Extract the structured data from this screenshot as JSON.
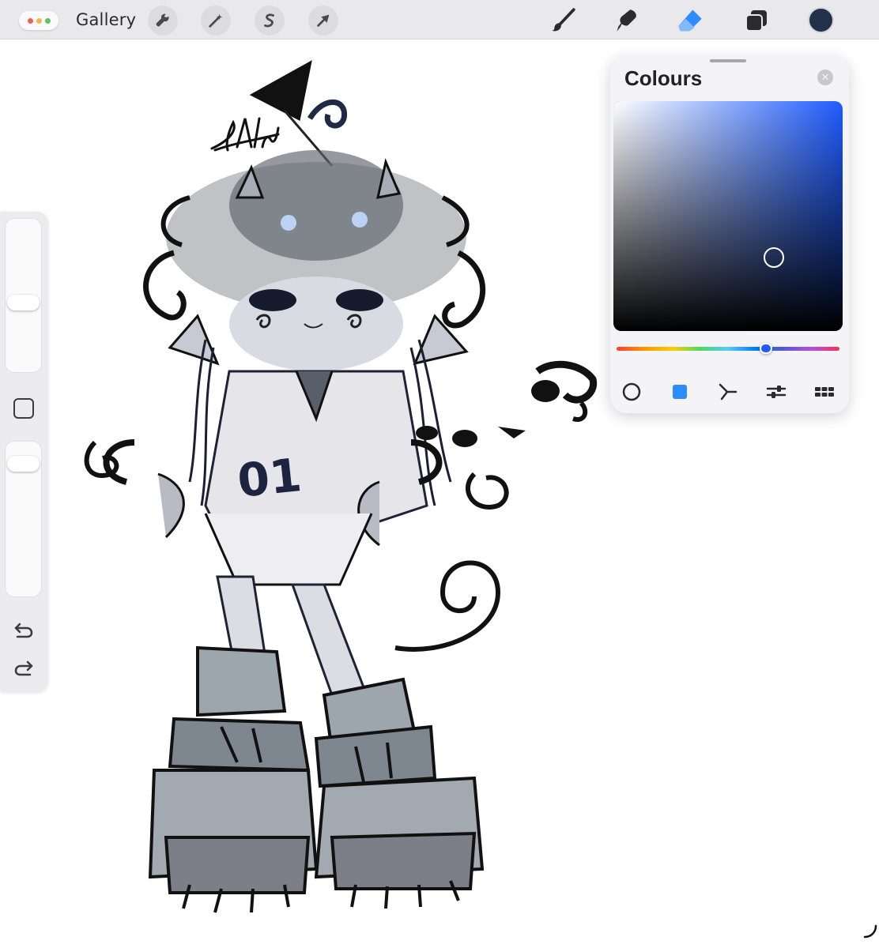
{
  "toolbar": {
    "gallery_label": "Gallery",
    "window_dots": [
      "#f0605a",
      "#f2b84a",
      "#5bc45a"
    ],
    "left_tools": [
      "wrench-icon",
      "magic-wand-icon",
      "selection-icon",
      "transform-arrow-icon"
    ],
    "right_tools": [
      "brush-icon",
      "smudge-icon",
      "eraser-icon",
      "layers-icon"
    ],
    "active_tool": "eraser-icon",
    "current_color": "#23324a"
  },
  "sidebar": {
    "brush_size_level": 0.45,
    "opacity_level": 0.08,
    "icons": [
      "modify-square-icon",
      "undo-icon",
      "redo-icon"
    ]
  },
  "colours_panel": {
    "title": "Colours",
    "hue_color": "#1f5cff",
    "saturation": 0.7,
    "brightness": 0.32,
    "hue_position": 0.67,
    "modes": [
      "disc-icon",
      "classic-icon",
      "harmony-icon",
      "value-icon",
      "palettes-icon"
    ],
    "active_mode": "classic-icon",
    "accent_color": "#2d8cff"
  },
  "canvas": {
    "artwork": "hand-drawn-character-artwork",
    "signature": "Allie",
    "shirt_number": "01"
  }
}
